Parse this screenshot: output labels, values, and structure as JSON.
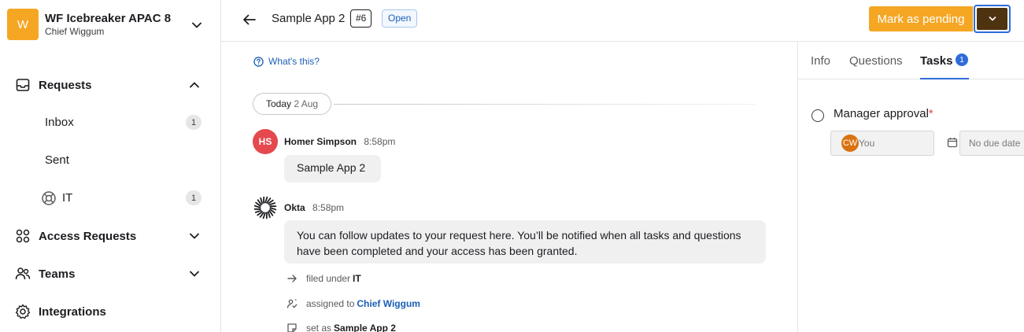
{
  "workspace": {
    "avatar_letter": "W",
    "name": "WF Icebreaker APAC 8",
    "user": "Chief Wiggum"
  },
  "sidebar": {
    "requests": {
      "label": "Requests",
      "icon": "inbox-icon"
    },
    "inbox": {
      "label": "Inbox",
      "count": "1"
    },
    "sent": {
      "label": "Sent"
    },
    "it": {
      "label": "IT",
      "count": "1",
      "icon": "lifebuoy-icon"
    },
    "access_requests": {
      "label": "Access Requests",
      "icon": "apps-grid-icon"
    },
    "teams": {
      "label": "Teams",
      "icon": "people-icon"
    },
    "integrations": {
      "label": "Integrations",
      "icon": "gear-icon"
    }
  },
  "header": {
    "title": "Sample App 2",
    "number": "#6",
    "status": "Open",
    "primary_action": "Mark as pending"
  },
  "timeline": {
    "whats_this": "What's this?",
    "date_today": "Today",
    "date_value": "2 Aug",
    "messages": [
      {
        "initials": "HS",
        "author": "Homer Simpson",
        "time": "8:58pm",
        "text": "Sample App 2"
      },
      {
        "author": "Okta",
        "time": "8:58pm",
        "text": "You can follow updates to your request here. You’ll be notified when all tasks and questions have been completed and your access has been granted."
      }
    ],
    "events": [
      {
        "prefix": "filed under",
        "value": "IT"
      },
      {
        "prefix": "assigned to",
        "value": "Chief Wiggum"
      },
      {
        "prefix": "set as",
        "value": "Sample App 2"
      }
    ]
  },
  "panel": {
    "tabs": [
      "Info",
      "Questions",
      "Tasks"
    ],
    "tasks_badge": "1",
    "task": {
      "title": "Manager approval",
      "required_mark": "*",
      "assignee_initials": "CW",
      "assignee_label": "You",
      "due_placeholder": "No due date"
    }
  },
  "colors": {
    "accent": "#f5a623",
    "dropdown_dark": "#4d330f",
    "link_blue": "#1a5fb4",
    "focus_blue": "#2e6cd9",
    "error_red": "#e5484d"
  }
}
